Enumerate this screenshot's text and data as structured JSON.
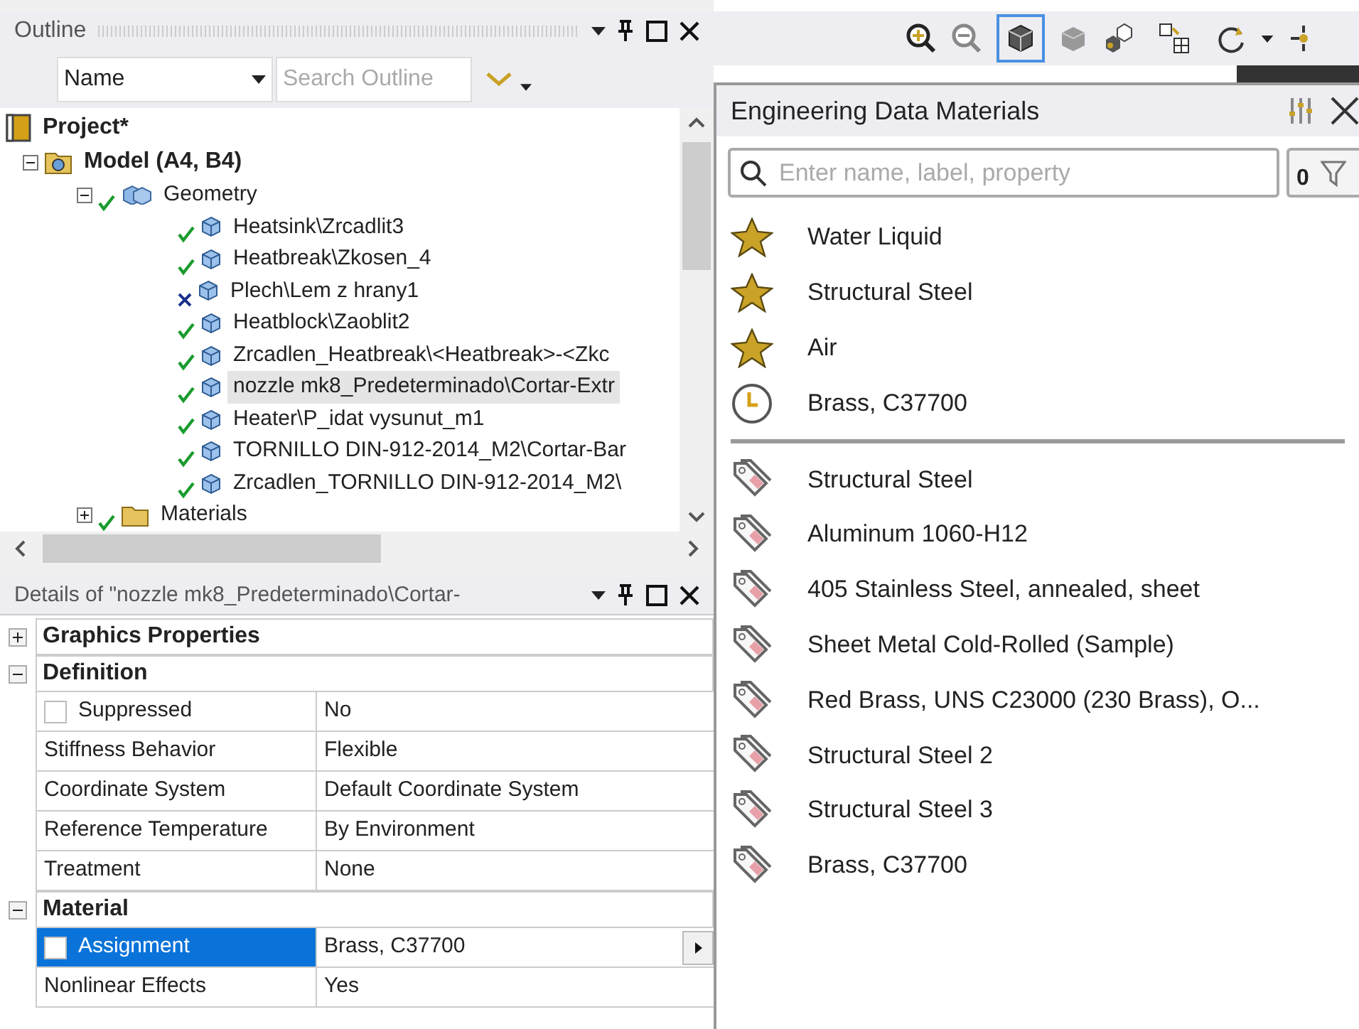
{
  "outline": {
    "title": "Outline",
    "sort_field": {
      "value": "Name"
    },
    "search": {
      "placeholder": "Search Outline"
    },
    "tree": [
      {
        "label": "Project*",
        "kind": "project",
        "selected": false,
        "children": [
          {
            "label": "Model (A4, B4)",
            "kind": "model",
            "expanded": true,
            "selected": false,
            "children": [
              {
                "label": "Geometry",
                "kind": "geometry",
                "error": false,
                "expanded": true,
                "selected": false,
                "children": [
                  {
                    "label": "Heatsink\\Zrcadlit3",
                    "kind": "body",
                    "error": false,
                    "selected": false
                  },
                  {
                    "label": "Heatbreak\\Zkosen_4",
                    "kind": "body",
                    "error": false,
                    "selected": false
                  },
                  {
                    "label": "Plech\\Lem z hrany1",
                    "kind": "body",
                    "error": true,
                    "selected": false
                  },
                  {
                    "label": "Heatblock\\Zaoblit2",
                    "kind": "body",
                    "error": false,
                    "selected": false
                  },
                  {
                    "label": "Zrcadlen_Heatbreak\\<Heatbreak>-<Zkc",
                    "kind": "body",
                    "error": false,
                    "selected": false
                  },
                  {
                    "label": "nozzle mk8_Predeterminado\\Cortar-Extr",
                    "kind": "body",
                    "error": false,
                    "selected": true
                  },
                  {
                    "label": "Heater\\P_idat vysunut_m1",
                    "kind": "body",
                    "error": false,
                    "selected": false
                  },
                  {
                    "label": "TORNILLO DIN-912-2014_M2\\Cortar-Bar",
                    "kind": "body",
                    "error": false,
                    "selected": false
                  },
                  {
                    "label": "Zrcadlen_TORNILLO DIN-912-2014_M2\\",
                    "kind": "body",
                    "error": false,
                    "selected": false
                  }
                ]
              },
              {
                "label": "Materials",
                "kind": "materials",
                "error": false,
                "expanded": false,
                "selected": false
              }
            ]
          }
        ]
      }
    ]
  },
  "details": {
    "title": "Details of \"nozzle mk8_Predeterminado\\Cortar-",
    "groups": [
      {
        "label": "Graphics Properties",
        "expanded": false
      },
      {
        "label": "Definition",
        "expanded": true,
        "rows": [
          {
            "property": "Suppressed",
            "value": "No",
            "kind": "checkbox",
            "checked": false,
            "selected": false
          },
          {
            "property": "Stiffness Behavior",
            "value": "Flexible",
            "kind": "text",
            "selected": false
          },
          {
            "property": "Coordinate System",
            "value": "Default Coordinate System",
            "kind": "text",
            "selected": false
          },
          {
            "property": "Reference Temperature",
            "value": "By Environment",
            "kind": "text",
            "selected": false
          },
          {
            "property": "Treatment",
            "value": "None",
            "kind": "text",
            "selected": false
          }
        ]
      },
      {
        "label": "Material",
        "expanded": true,
        "rows": [
          {
            "property": "Assignment",
            "value": "Brass, C37700",
            "kind": "picker",
            "checked": false,
            "selected": true
          },
          {
            "property": "Nonlinear Effects",
            "value": "Yes",
            "kind": "text",
            "selected": false
          }
        ]
      }
    ]
  },
  "materials_panel": {
    "title": "Engineering Data Materials",
    "search": {
      "placeholder": "Enter name, label, property"
    },
    "filter_count": "0",
    "recent": [
      {
        "name": "Water Liquid",
        "kind": "favorite"
      },
      {
        "name": "Structural Steel",
        "kind": "favorite"
      },
      {
        "name": "Air",
        "kind": "favorite"
      },
      {
        "name": "Brass, C37700",
        "kind": "recent"
      }
    ],
    "library": [
      {
        "name": "Structural Steel"
      },
      {
        "name": "Aluminum 1060-H12"
      },
      {
        "name": "405 Stainless Steel, annealed, sheet"
      },
      {
        "name": "Sheet Metal Cold-Rolled (Sample)"
      },
      {
        "name": "Red Brass, UNS C23000 (230 Brass), O..."
      },
      {
        "name": "Structural Steel 2"
      },
      {
        "name": "Structural Steel 3"
      },
      {
        "name": "Brass, C37700"
      }
    ]
  }
}
